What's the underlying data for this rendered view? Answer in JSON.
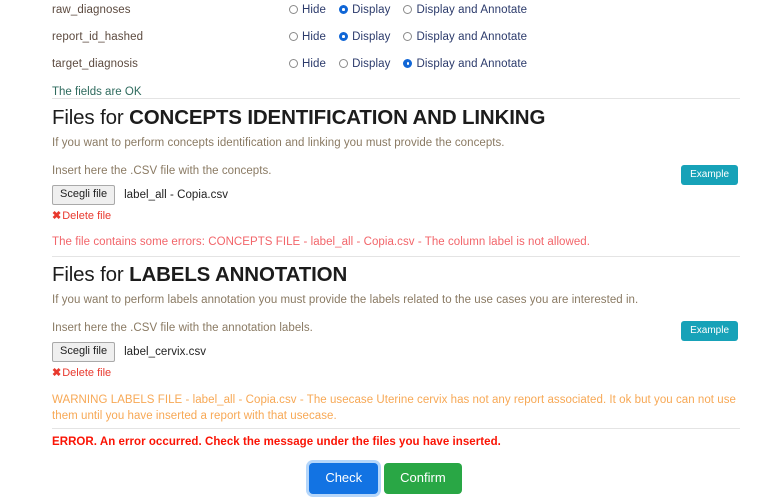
{
  "fields_section": {
    "rows": [
      {
        "name": "raw_diagnoses",
        "options": [
          {
            "label": "Hide",
            "selected": false
          },
          {
            "label": "Display",
            "selected": true
          },
          {
            "label": "Display and Annotate",
            "selected": false
          }
        ]
      },
      {
        "name": "report_id_hashed",
        "options": [
          {
            "label": "Hide",
            "selected": false
          },
          {
            "label": "Display",
            "selected": true
          },
          {
            "label": "Display and Annotate",
            "selected": false
          }
        ]
      },
      {
        "name": "target_diagnosis",
        "options": [
          {
            "label": "Hide",
            "selected": false
          },
          {
            "label": "Display",
            "selected": false
          },
          {
            "label": "Display and Annotate",
            "selected": true
          }
        ]
      }
    ],
    "status": "The fields are OK"
  },
  "concepts_section": {
    "title_prefix": "Files for ",
    "title_bold": "CONCEPTS IDENTIFICATION AND LINKING",
    "description": "If you want to perform concepts identification and linking you must provide the concepts.",
    "insert_label": "Insert here the .CSV file with the concepts.",
    "example_label": "Example",
    "file_button_label": "Scegli file",
    "file_name": "label_all - Copia.csv",
    "delete_label": "Delete file",
    "delete_icon": "x-mark-icon",
    "error_message": "The file contains some errors: CONCEPTS FILE - label_all - Copia.csv - The column label is not allowed."
  },
  "labels_section": {
    "title_prefix": "Files for ",
    "title_bold": "LABELS ANNOTATION",
    "description": "If you want to perform labels annotation you must provide the labels related to the use cases you are interested in.",
    "insert_label": "Insert here the .CSV file with the annotation labels.",
    "example_label": "Example",
    "file_button_label": "Scegli file",
    "file_name": "label_cervix.csv",
    "delete_label": "Delete file",
    "delete_icon": "x-mark-icon",
    "warning_message": "WARNING LABELS FILE - label_all - Copia.csv - The usecase Uterine cervix has not any report associated. It ok but you can not use them until you have inserted a report with that usecase."
  },
  "footer": {
    "error_message": "ERROR. An error occurred. Check the message under the files you have inserted.",
    "check_label": "Check",
    "confirm_label": "Confirm"
  },
  "colors": {
    "example_button": "#17a2b8",
    "check_button": "#1273e3",
    "confirm_button": "#29a745",
    "error_text": "#fa1405",
    "warning_text": "#f7a855",
    "file_error_text": "#f2656a",
    "ok_text": "#2f6b5e",
    "radio_selected": "#1066d6"
  }
}
